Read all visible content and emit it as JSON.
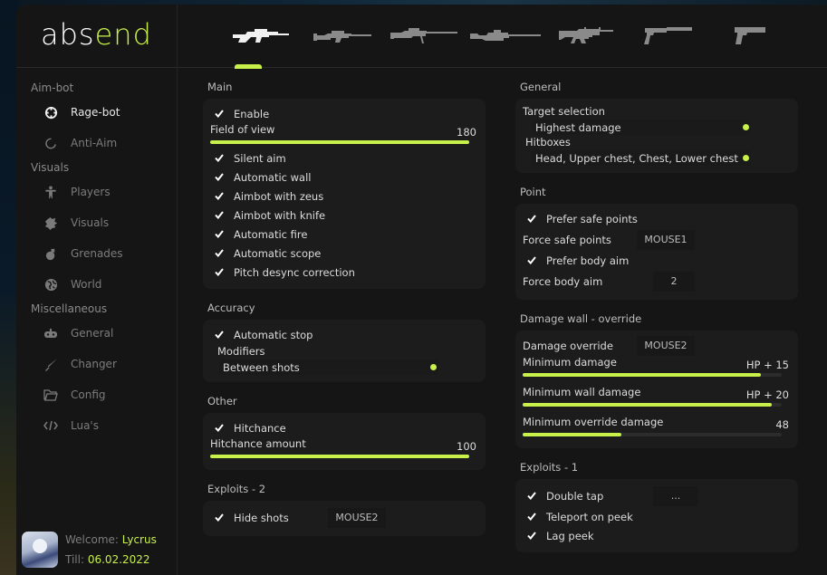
{
  "app": {
    "logo_part1": "abs",
    "logo_part2": "end",
    "accent": "#c8f04a"
  },
  "weapons": [
    {
      "name": "auto-sniper",
      "active": true
    },
    {
      "name": "scout",
      "active": false
    },
    {
      "name": "awp",
      "active": false
    },
    {
      "name": "sniper",
      "active": false
    },
    {
      "name": "rifle",
      "active": false
    },
    {
      "name": "pistol-silenced",
      "active": false
    },
    {
      "name": "heavy-pistol",
      "active": false
    }
  ],
  "sidebar": {
    "sections": [
      {
        "title": "Aim-bot",
        "items": [
          {
            "label": "Rage-bot",
            "icon": "crosshair-icon",
            "active": true
          },
          {
            "label": "Anti-Aim",
            "icon": "spinner-icon",
            "active": false
          }
        ]
      },
      {
        "title": "Visuals",
        "items": [
          {
            "label": "Players",
            "icon": "person-icon",
            "active": false
          },
          {
            "label": "Visuals",
            "icon": "splash-icon",
            "active": false
          },
          {
            "label": "Grenades",
            "icon": "grenade-icon",
            "active": false
          },
          {
            "label": "World",
            "icon": "globe-icon",
            "active": false
          }
        ]
      },
      {
        "title": "Miscellaneous",
        "items": [
          {
            "label": "General",
            "icon": "gamepad-icon",
            "active": false
          },
          {
            "label": "Changer",
            "icon": "knife-icon",
            "active": false
          },
          {
            "label": "Config",
            "icon": "folder-icon",
            "active": false
          },
          {
            "label": "Lua's",
            "icon": "code-icon",
            "active": false
          }
        ]
      }
    ]
  },
  "user": {
    "welcome_label": "Welcome:",
    "name": "Lycrus",
    "till_label": "Till:",
    "till_date": "06.02.2022"
  },
  "left": {
    "main": {
      "title": "Main",
      "enable": "Enable",
      "fov": {
        "label": "Field of view",
        "value": "180",
        "fraction": 1.0
      },
      "checks": [
        "Silent aim",
        "Automatic wall",
        "Aimbot with zeus",
        "Aimbot with knife",
        "Automatic fire",
        "Automatic scope",
        "Pitch desync correction"
      ]
    },
    "accuracy": {
      "title": "Accuracy",
      "auto_stop": "Automatic stop",
      "modifiers_label": "Modifiers",
      "modifiers_value": "Between shots"
    },
    "other": {
      "title": "Other",
      "hitchance": "Hitchance",
      "amount": {
        "label": "Hitchance amount",
        "value": "100",
        "fraction": 1.0
      }
    },
    "exploits2": {
      "title": "Exploits - 2",
      "hide_shots": "Hide shots",
      "hide_shots_key": "MOUSE2"
    }
  },
  "right": {
    "general": {
      "title": "General",
      "target_label": "Target selection",
      "target_value": "Highest damage",
      "hitboxes_label": "Hitboxes",
      "hitboxes_value": "Head, Upper chest, Chest, Lower chest"
    },
    "point": {
      "title": "Point",
      "prefer_safe": "Prefer safe points",
      "force_safe_label": "Force safe points",
      "force_safe_key": "MOUSE1",
      "prefer_body": "Prefer body aim",
      "force_body_label": "Force body aim",
      "force_body_key": "2"
    },
    "damage": {
      "title": "Damage wall - override",
      "override_label": "Damage override",
      "override_key": "MOUSE2",
      "min_damage": {
        "label": "Minimum damage",
        "value": "HP + 15",
        "fraction": 0.92
      },
      "min_wall": {
        "label": "Minimum wall damage",
        "value": "HP + 20",
        "fraction": 0.96
      },
      "min_override": {
        "label": "Minimum override damage",
        "value": "48",
        "fraction": 0.38
      }
    },
    "exploits1": {
      "title": "Exploits - 1",
      "double_tap": "Double tap",
      "double_tap_key": "...",
      "teleport": "Teleport on peek",
      "lag_peek": "Lag peek"
    }
  }
}
